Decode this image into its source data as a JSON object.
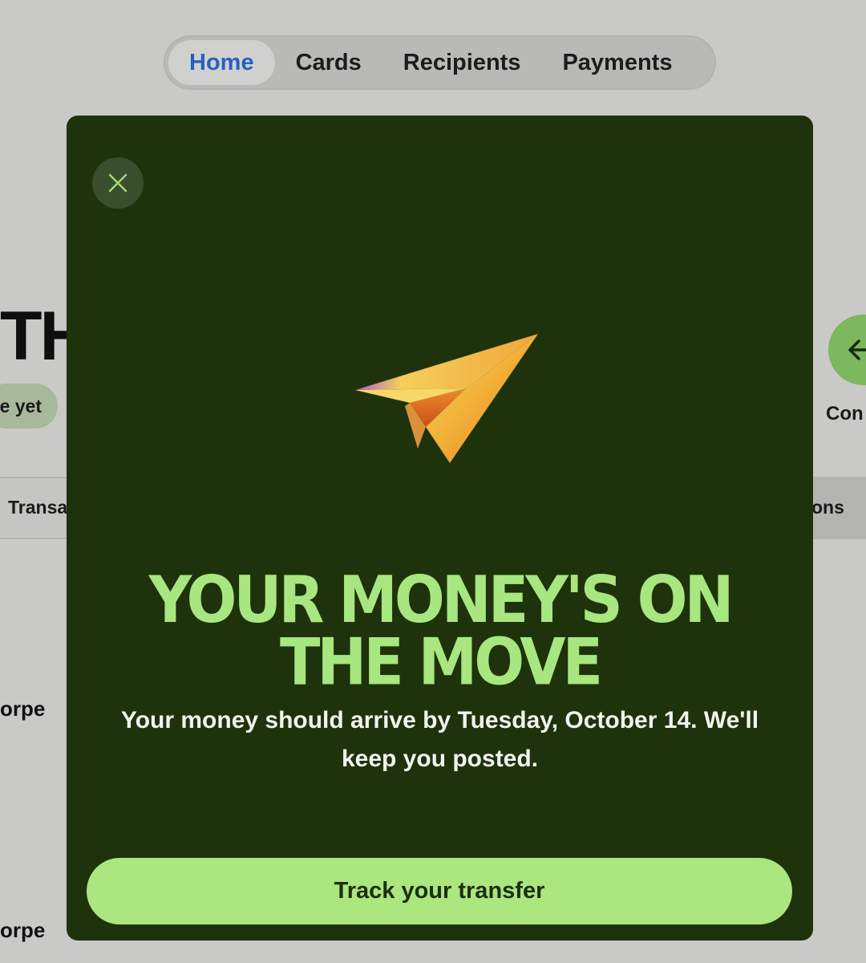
{
  "nav": {
    "tabs": [
      {
        "label": "Home",
        "active": true
      },
      {
        "label": "Cards",
        "active": false
      },
      {
        "label": "Recipients",
        "active": false
      },
      {
        "label": "Payments",
        "active": false
      }
    ]
  },
  "background": {
    "heading_fragment": "TH",
    "pill_fragment": "e yet",
    "tab_left_fragment": "Transa",
    "tab_right_fragment": "ons",
    "round_button_label_fragment": "Con",
    "name_fragment_1": "orpe",
    "name_fragment_2": "orpe"
  },
  "modal": {
    "close_icon": "close-icon",
    "illustration": "paper-plane-icon",
    "title": "YOUR MONEY'S ON THE MOVE",
    "body": "Your money should arrive by Tuesday, October 14. We'll keep you posted.",
    "cta_label": "Track your transfer"
  },
  "colors": {
    "modal_bg": "#1e320c",
    "accent_green": "#abe67e",
    "title_green": "#a8e680",
    "active_tab_text": "#2b5fbf"
  }
}
